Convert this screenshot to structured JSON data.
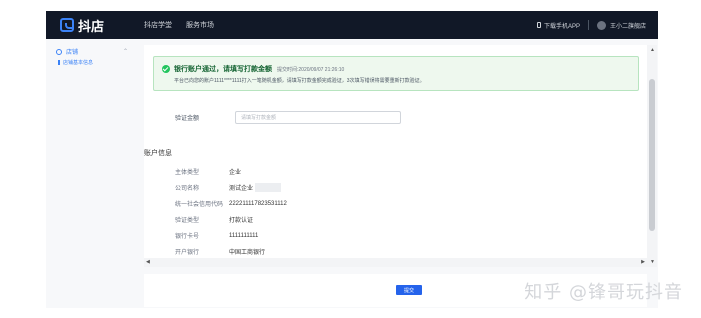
{
  "header": {
    "logo_text": "抖店",
    "nav": [
      "抖店学堂",
      "服务市场"
    ],
    "download_label": "下载手机APP",
    "username": "王小二旗舰店"
  },
  "sidebar": {
    "group_label": "店铺",
    "items": [
      {
        "label": "店铺基本信息"
      }
    ]
  },
  "alert": {
    "title": "银行账户通过，请填写打款金额",
    "time_text": "提交时间:2020/09/07 21:26:10",
    "desc": "平台已向您的账户1111****1111打入一笔随机金额，请填写打款金额完成验证，3次填写错误将需要重新打款验证。"
  },
  "verify": {
    "label": "验证金额",
    "placeholder": "请填写打款金额"
  },
  "account": {
    "title": "账户信息",
    "rows": [
      {
        "label": "主体类型",
        "value": "企业"
      },
      {
        "label": "公司名称",
        "value": "测试企业"
      },
      {
        "label": "统一社会信用代码",
        "value": "222211117823531112"
      },
      {
        "label": "验证类型",
        "value": "打款认证"
      },
      {
        "label": "银行卡号",
        "value": "1111111111"
      },
      {
        "label": "开户银行",
        "value": "中国工商银行"
      }
    ]
  },
  "footer": {
    "submit_label": "提交"
  },
  "watermark": "知乎 @锋哥玩抖音"
}
